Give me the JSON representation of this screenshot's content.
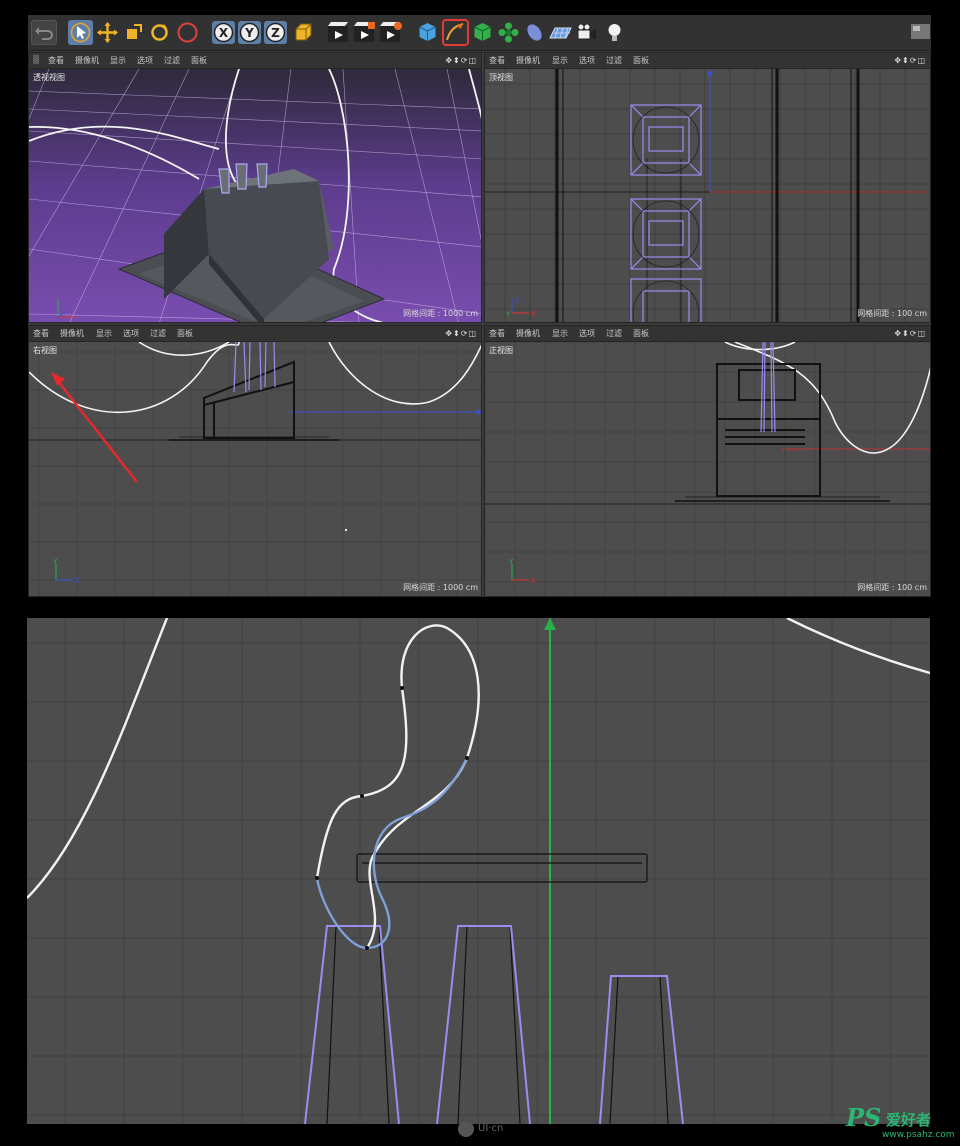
{
  "toolbar": {
    "icons": [
      "undo-icon",
      "select-arrow-icon",
      "move-icon",
      "scale-icon",
      "rotate-icon",
      "live-select-icon",
      "x-axis-lock-icon",
      "y-axis-lock-icon",
      "z-axis-lock-icon",
      "coordinate-system-icon",
      "render-view-icon",
      "render-to-picture-viewer-icon",
      "render-settings-icon",
      "cube-icon",
      "pen-spline-icon",
      "subdivision-icon",
      "cloner-icon",
      "deformer-icon",
      "floor-icon",
      "camera-icon",
      "light-icon",
      "layout-icon"
    ],
    "axis_labels": {
      "x": "X",
      "y": "Y",
      "z": "Z"
    }
  },
  "viewport_menu": [
    "查看",
    "摄像机",
    "显示",
    "选项",
    "过滤",
    "面板"
  ],
  "viewport_controls": "✥⬍⟳◫",
  "viewports": {
    "perspective": {
      "name": "透视视图",
      "grid_spacing": "网格间距 : 1000 cm"
    },
    "top": {
      "name": "顶视图",
      "grid_spacing": "网格间距 : 100 cm"
    },
    "right": {
      "name": "右视图",
      "grid_spacing": "网格间距 : 1000 cm"
    },
    "front": {
      "name": "正视图",
      "grid_spacing": "网格间距 : 100 cm"
    }
  },
  "axes": {
    "x": "X",
    "y": "Y",
    "z": "Z"
  },
  "colors": {
    "viewport_bg": "#4d4d4d",
    "spline_white": "#f2f2f2",
    "spline_blue": "#7f9fd8",
    "selected_outline": "#9b8cf0",
    "axis_green": "#29b24a",
    "axis_blue": "#3c4fd6",
    "axis_red": "#d33",
    "annotation_arrow": "#e8282a",
    "highlight_red": "#e43b33"
  },
  "watermarks": {
    "uicn": "UI·cn",
    "ps_logo": "PS",
    "ps_cn": "爱好者",
    "ps_url": "www.psahz.com"
  }
}
